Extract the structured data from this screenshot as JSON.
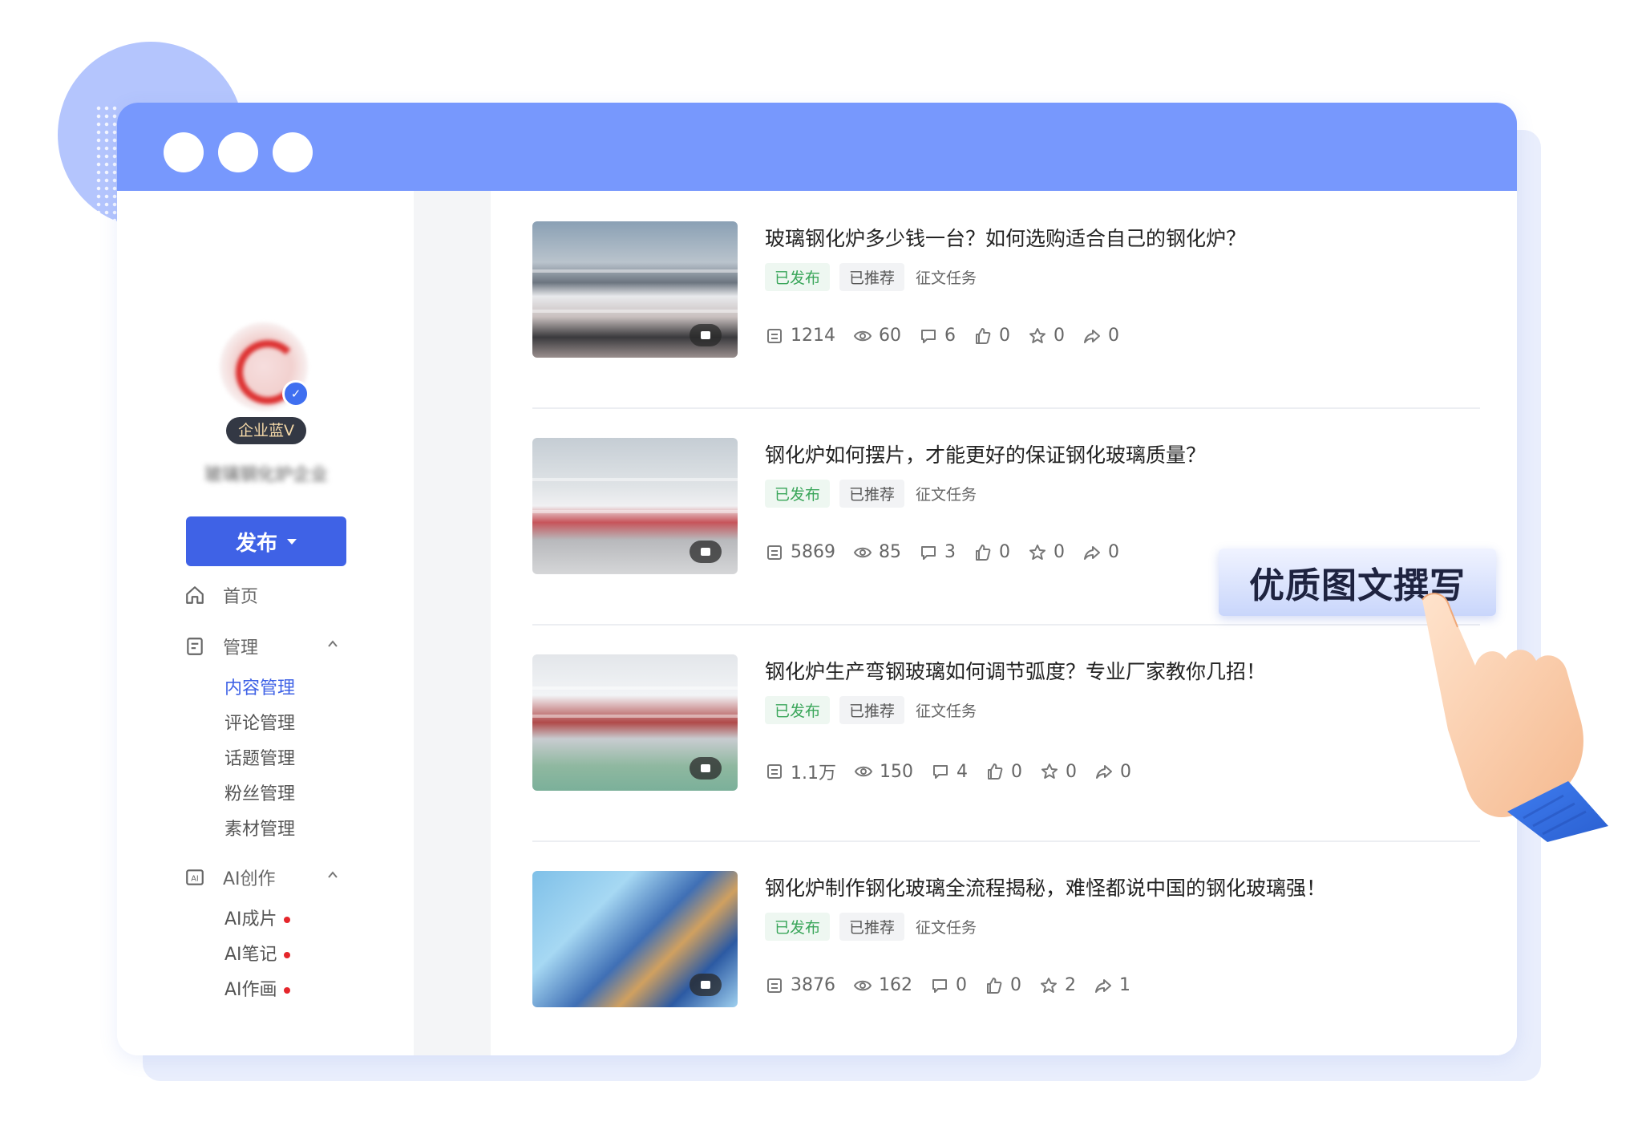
{
  "sidebar": {
    "badge": "企业蓝V",
    "account_name": "玻璃钢化炉企业",
    "publish_label": "发布",
    "nav": {
      "home": "首页",
      "manage": "管理",
      "manage_items": [
        "内容管理",
        "评论管理",
        "话题管理",
        "粉丝管理",
        "素材管理"
      ],
      "ai": "AI创作",
      "ai_items": [
        "AI成片",
        "AI笔记",
        "AI作画"
      ]
    }
  },
  "articles": [
    {
      "title": "玻璃钢化炉多少钱一台？如何选购适合自己的钢化炉？",
      "tags": [
        "已发布",
        "已推荐",
        "征文任务"
      ],
      "reads": "1214",
      "views": "60",
      "comments": "6",
      "likes": "0",
      "favorites": "0",
      "shares": "0"
    },
    {
      "title": "钢化炉如何摆片，才能更好的保证钢化玻璃质量？",
      "tags": [
        "已发布",
        "已推荐",
        "征文任务"
      ],
      "reads": "5869",
      "views": "85",
      "comments": "3",
      "likes": "0",
      "favorites": "0",
      "shares": "0"
    },
    {
      "title": "钢化炉生产弯钢玻璃如何调节弧度？专业厂家教你几招！",
      "tags": [
        "已发布",
        "已推荐",
        "征文任务"
      ],
      "reads": "1.1万",
      "views": "150",
      "comments": "4",
      "likes": "0",
      "favorites": "0",
      "shares": "0"
    },
    {
      "title": "钢化炉制作钢化玻璃全流程揭秘，难怪都说中国的钢化玻璃强！",
      "tags": [
        "已发布",
        "已推荐",
        "征文任务"
      ],
      "reads": "3876",
      "views": "162",
      "comments": "0",
      "likes": "0",
      "favorites": "2",
      "shares": "1"
    }
  ],
  "callout": "优质图文撰写",
  "colors": {
    "titlebar": "#7798fd",
    "accent": "#3f62e6",
    "published_green": "#3aa65a",
    "badge_dot_red": "#e5262b"
  }
}
